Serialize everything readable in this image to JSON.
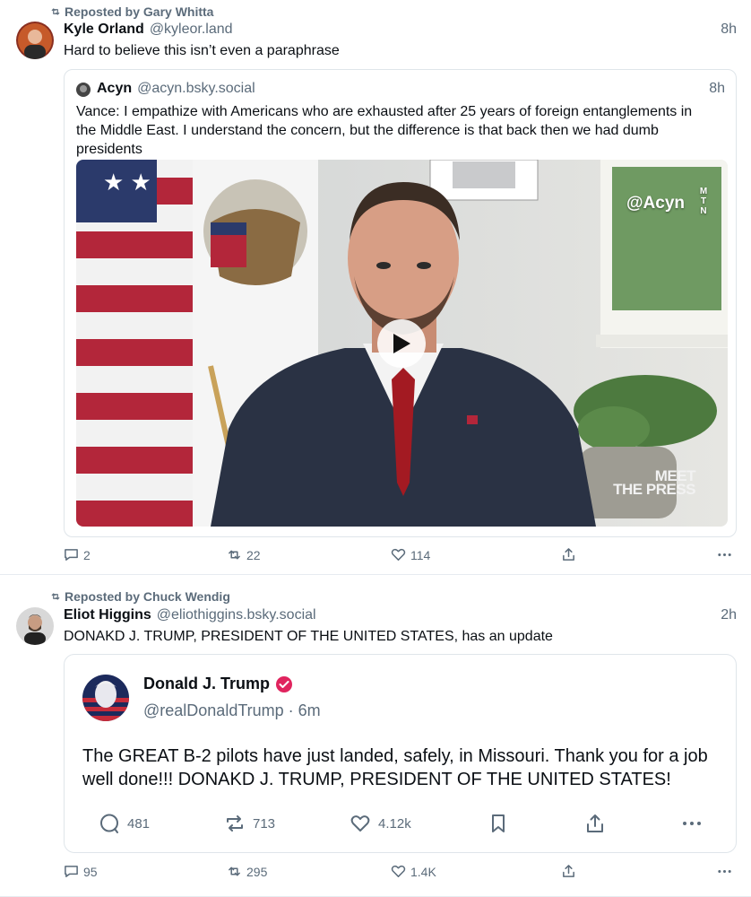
{
  "colors": {
    "muted": "#5b6b7a",
    "text": "#0b0f14",
    "border": "#dfe5ea",
    "verified": "#e0245e"
  },
  "feed": [
    {
      "repost_label": "Reposted by Gary Whitta",
      "author_name": "Kyle Orland",
      "author_handle": "@kyleor.land",
      "time": "8h",
      "text": "Hard to believe this isn’t even a paraphrase",
      "quote": {
        "author_name": "Acyn",
        "author_handle": "@acyn.bsky.social",
        "time": "8h",
        "text": "Vance: I empathize with Americans who are exhausted after 25 years of foreign entanglements in the Middle East. I understand the concern, but the difference is that back then we had dumb presidents",
        "video_watermark": "@Acyn",
        "video_badge": "M T N",
        "network_logo_line1": "MEET",
        "network_logo_line2": "THE PRESS"
      },
      "actions": {
        "replies": "2",
        "reposts": "22",
        "likes": "114"
      }
    },
    {
      "repost_label": "Reposted by Chuck Wendig",
      "author_name": "Eliot Higgins",
      "author_handle": "@eliothiggins.bsky.social",
      "time": "2h",
      "text": "DONAKD J. TRUMP, PRESIDENT OF THE UNITED STATES, has an update",
      "embed": {
        "author_name": "Donald J. Trump",
        "author_handle": "@realDonaldTrump · 6m",
        "text": "The GREAT B-2 pilots have just landed, safely, in Missouri. Thank you for a job well done!!! DONAKD J. TRUMP, PRESIDENT OF THE UNITED STATES!",
        "replies": "481",
        "retruths": "713",
        "likes": "4.12k"
      },
      "actions": {
        "replies": "95",
        "reposts": "295",
        "likes": "1.4K"
      }
    }
  ]
}
